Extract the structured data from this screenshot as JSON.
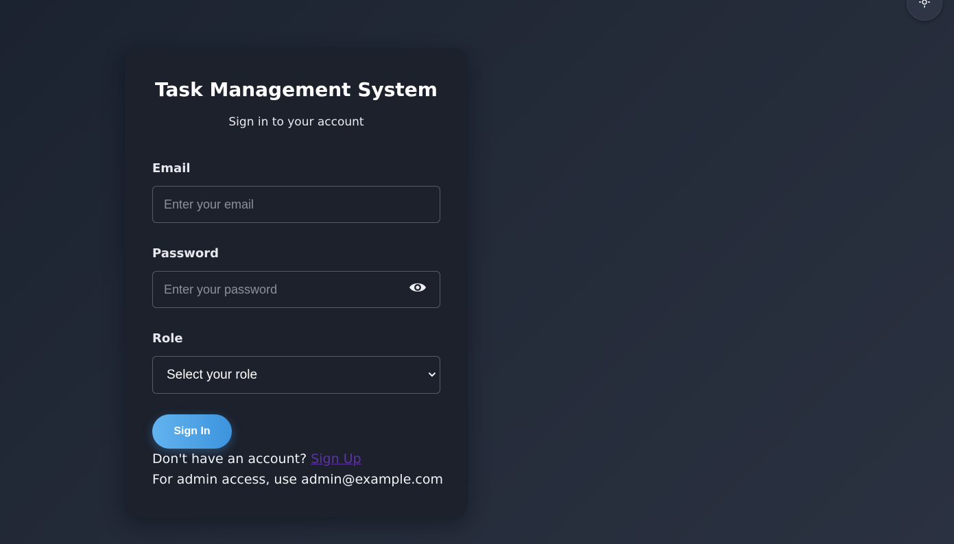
{
  "theme_toggle": {
    "icon": "sun-icon"
  },
  "login": {
    "title": "Task Management System",
    "subtitle": "Sign in to your account",
    "email": {
      "label": "Email",
      "placeholder": "Enter your email",
      "value": ""
    },
    "password": {
      "label": "Password",
      "placeholder": "Enter your password",
      "value": "",
      "toggle_icon": "eye-icon"
    },
    "role": {
      "label": "Role",
      "selected": "Select your role"
    },
    "submit_label": "Sign In",
    "signup_prompt": "Don't have an account?",
    "signup_link": "Sign Up",
    "admin_note": "For admin access, use admin@example.com"
  },
  "colors": {
    "accent": "#4aa3e6",
    "card_bg": "#1c212c",
    "link": "#5e33a8"
  }
}
